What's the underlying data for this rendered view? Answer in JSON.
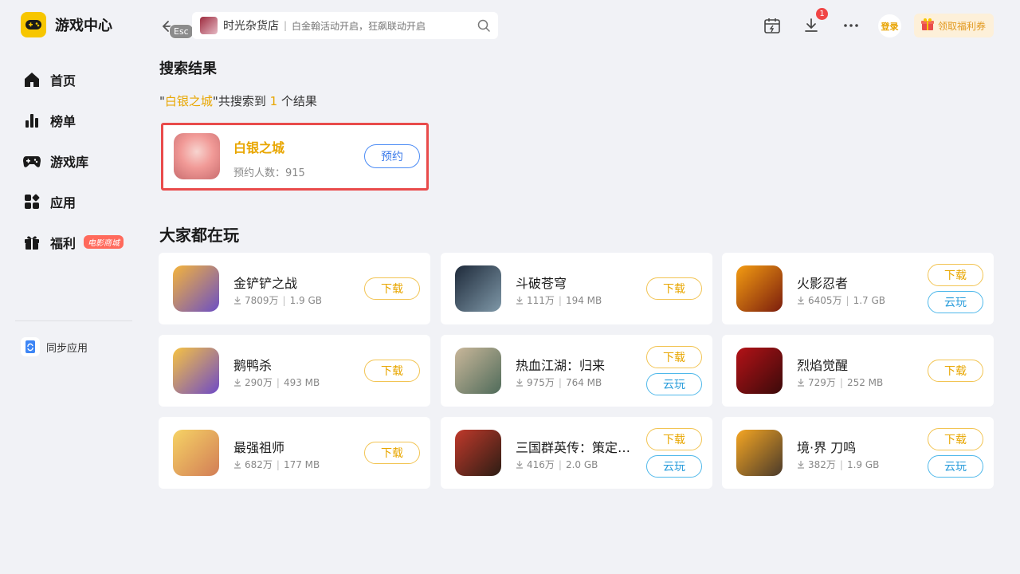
{
  "app": {
    "title": "游戏中心"
  },
  "sidebar": {
    "items": [
      {
        "label": "首页",
        "icon": "home-icon"
      },
      {
        "label": "榜单",
        "icon": "ranking-icon"
      },
      {
        "label": "游戏库",
        "icon": "gamepad-icon"
      },
      {
        "label": "应用",
        "icon": "apps-icon"
      },
      {
        "label": "福利",
        "icon": "gift-icon",
        "badge": "电影商城"
      }
    ],
    "sync_label": "同步应用"
  },
  "topbar": {
    "esc_label": "Esc",
    "search_value": "时光杂货店",
    "search_separator": "|",
    "search_placeholder": "白金翰活动开启，狂飙联动开启",
    "download_badge": "1",
    "login_label": "登录",
    "coupon_label": "领取福利券"
  },
  "search": {
    "title": "搜索结果",
    "summary_open": "\"",
    "summary_keyword": "白银之城",
    "summary_mid": "\"共搜索到 ",
    "summary_count": "1",
    "summary_end": " 个结果",
    "result": {
      "name": "白银之城",
      "count_label": "预约人数：915",
      "button": "预约"
    }
  },
  "popular": {
    "title": "大家都在玩",
    "download_label": "下载",
    "cloud_label": "云玩",
    "games": [
      {
        "name": "金铲铲之战",
        "downloads": "7809万",
        "size": "1.9 GB",
        "cloud": false
      },
      {
        "name": "斗破苍穹",
        "downloads": "111万",
        "size": "194 MB",
        "cloud": false
      },
      {
        "name": "火影忍者",
        "downloads": "6405万",
        "size": "1.7 GB",
        "cloud": true
      },
      {
        "name": "鹅鸭杀",
        "downloads": "290万",
        "size": "493 MB",
        "cloud": false
      },
      {
        "name": "热血江湖：归来",
        "downloads": "975万",
        "size": "764 MB",
        "cloud": true
      },
      {
        "name": "烈焰觉醒",
        "downloads": "729万",
        "size": "252 MB",
        "cloud": false
      },
      {
        "name": "最强祖师",
        "downloads": "682万",
        "size": "177 MB",
        "cloud": false
      },
      {
        "name": "三国群英传：策定九州",
        "downloads": "416万",
        "size": "2.0 GB",
        "cloud": true
      },
      {
        "name": "境·界 刀鸣",
        "downloads": "382万",
        "size": "1.9 GB",
        "cloud": true
      }
    ]
  },
  "colors": {
    "accent": "#e8a600",
    "highlight_border": "#e94b4b",
    "reserve": "#3c7bea",
    "cloud": "#2a9ddb"
  }
}
